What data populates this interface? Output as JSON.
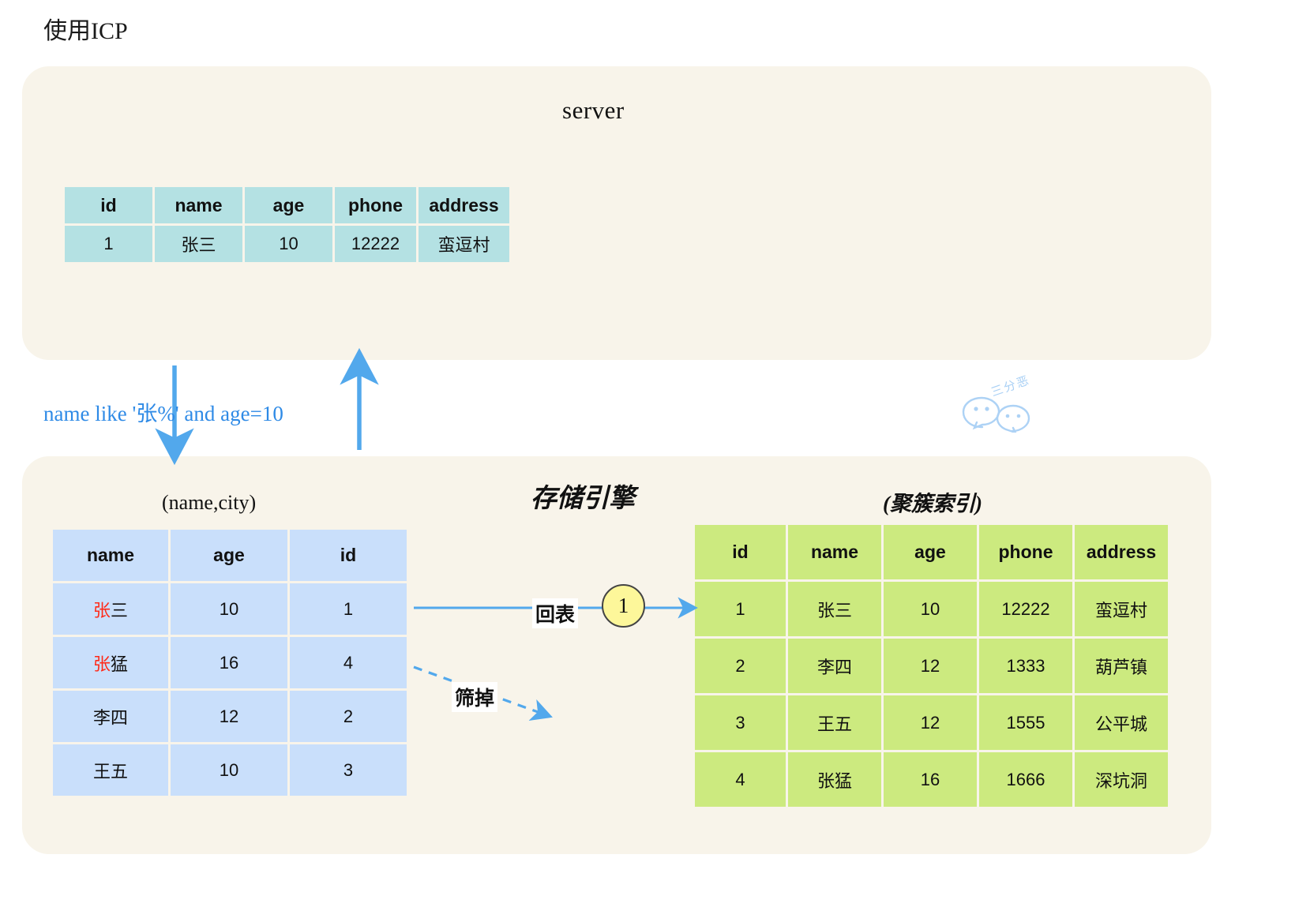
{
  "headline": "使用ICP",
  "server": {
    "title": "server",
    "table": {
      "columns": [
        "id",
        "name",
        "age",
        "phone",
        "address"
      ],
      "rows": [
        [
          "1",
          "张三",
          "10",
          "12222",
          "蛮逗村"
        ]
      ]
    }
  },
  "engine": {
    "title": "存储引擎",
    "secondary_index": {
      "label": "(name,city)",
      "columns": [
        "name",
        "age",
        "id"
      ],
      "rows": [
        {
          "name_red": "张",
          "name_rest": "三",
          "age": "10",
          "age_color": "red",
          "id": "1",
          "id_color": "red"
        },
        {
          "name_red": "张",
          "name_rest": "猛",
          "age": "16",
          "age_color": "red",
          "id": "4",
          "id_color": "blue"
        },
        {
          "name_red": "",
          "name_rest": "李四",
          "age": "12",
          "age_color": "black",
          "id": "2",
          "id_color": "black"
        },
        {
          "name_red": "",
          "name_rest": "王五",
          "age": "10",
          "age_color": "black",
          "id": "3",
          "id_color": "black"
        }
      ]
    },
    "clustered_index": {
      "label": "(聚簇索引)",
      "columns": [
        "id",
        "name",
        "age",
        "phone",
        "address"
      ],
      "rows": [
        {
          "id": "1",
          "id_color": "red",
          "name": "张三",
          "age": "10",
          "phone": "12222",
          "address": "蛮逗村"
        },
        {
          "id": "2",
          "id_color": "black",
          "name": "李四",
          "age": "12",
          "phone": "1333",
          "address": "葫芦镇"
        },
        {
          "id": "3",
          "id_color": "black",
          "name": "王五",
          "age": "12",
          "phone": "1555",
          "address": "公平城"
        },
        {
          "id": "4",
          "id_color": "black",
          "name": "张猛",
          "age": "16",
          "phone": "1666",
          "address": "深坑洞"
        }
      ]
    }
  },
  "flow": {
    "condition": "name like '张%' and age=10",
    "back_to_table_label": "回表",
    "filtered_out_label": "筛掉",
    "step_number": "1"
  },
  "watermark": {
    "text": "三分恶",
    "icon": "wechat-icon"
  },
  "colors": {
    "panel_bg": "#f8f4ea",
    "server_table": "#b4e1e3",
    "secondary_table": "#c9dffb",
    "clustered_table": "#ccea7f",
    "arrow": "#52a8ec",
    "accent_red": "#ff2a18",
    "accent_blue": "#3322dd",
    "step_circle": "#fdf79a"
  }
}
